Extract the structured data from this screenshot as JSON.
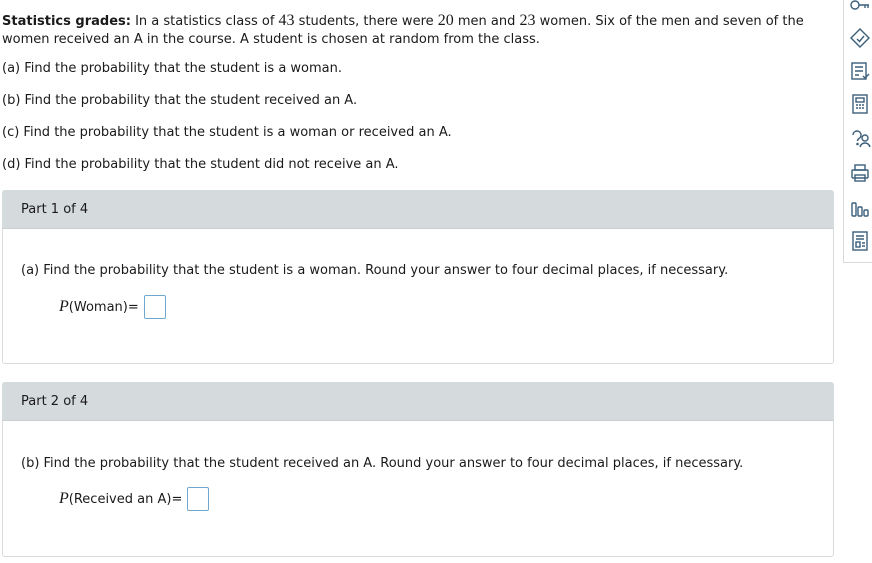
{
  "problem": {
    "title": "Statistics grades:",
    "t1": " In a statistics class of ",
    "n_total": "43",
    "t2": " students, there were ",
    "n_men": "20",
    "t3": " men and ",
    "n_women": "23",
    "t4": " women. Six of the men and seven of the women received an A in the course. A student is chosen at random from the class."
  },
  "questions": [
    "(a) Find the probability that the student is a woman.",
    "(b) Find the probability that the student received an A.",
    "(c) Find the probability that the student is a woman or received an A.",
    "(d) Find the probability that the student did not receive an A."
  ],
  "parts": [
    {
      "header": "Part 1 of 4",
      "question": "(a) Find the probability that the student is a woman. Round your answer to four decimal places, if necessary.",
      "p_symbol": "P",
      "event": "(Woman)",
      "equals": " =",
      "answer": ""
    },
    {
      "header": "Part 2 of 4",
      "question": "(b) Find the probability that the student received an A. Round your answer to four decimal places, if necessary.",
      "p_symbol": "P",
      "event": "(Received an A)",
      "equals": " =",
      "answer": ""
    }
  ],
  "toolbar": {
    "icons": [
      "key-icon",
      "tag-icon",
      "checklist-icon",
      "calculator-icon",
      "help-icon",
      "print-icon",
      "chart-icon",
      "notes-icon"
    ]
  },
  "colors": {
    "part_header_bg": "#d5dadd",
    "answer_border": "#6fa7cf",
    "icon_color": "#3b5f7a"
  }
}
